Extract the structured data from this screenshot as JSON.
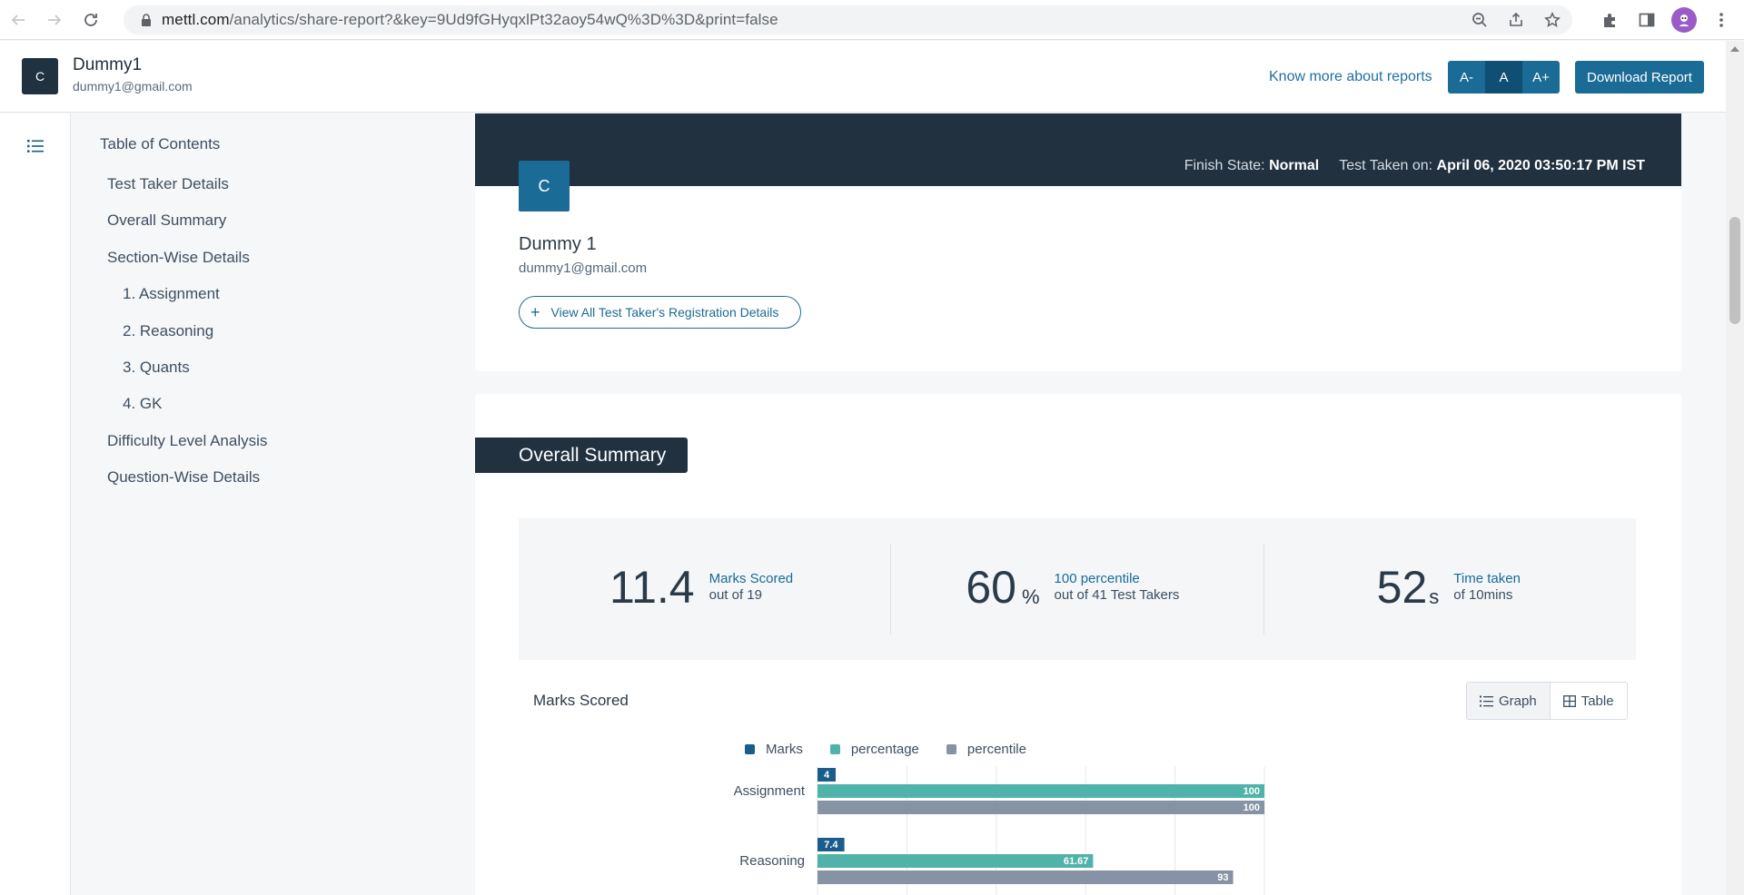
{
  "browser": {
    "url_host": "mettl.com",
    "url_rest": "/analytics/share-report?&key=9Ud9fGHyqxlPt32aoy54wQ%3D%3D&print=false"
  },
  "header": {
    "avatar_letter": "C",
    "user_name": "Dummy1",
    "user_email": "dummy1@gmail.com",
    "know_more": "Know more about reports",
    "font_decrease": "A-",
    "font_normal": "A",
    "font_increase": "A+",
    "download": "Download Report"
  },
  "toc": {
    "title": "Table of Contents",
    "items": [
      "Test Taker Details",
      "Overall Summary",
      "Section-Wise Details",
      "1. Assignment",
      "2. Reasoning",
      "3. Quants",
      "4. GK",
      "Difficulty Level Analysis",
      "Question-Wise Details"
    ]
  },
  "profile": {
    "finish_state_label": "Finish State:",
    "finish_state_value": "Normal",
    "taken_on_label": "Test Taken on:",
    "taken_on_value": "April 06, 2020 03:50:17 PM IST",
    "avatar_letter": "C",
    "name": "Dummy 1",
    "email": "dummy1@gmail.com",
    "registration_button": "View All Test Taker's Registration Details"
  },
  "summary": {
    "section_title": "Overall Summary",
    "stats": [
      {
        "value": "11.4",
        "unit": "",
        "label": "Marks Scored",
        "sub": "out of 19"
      },
      {
        "value": "60",
        "unit": "%",
        "label": "100 percentile",
        "sub": "out of 41 Test Takers"
      },
      {
        "value": "52",
        "unit": "s",
        "label": "Time taken",
        "sub": "of 10mins"
      }
    ],
    "chart_title": "Marks Scored",
    "view_graph": "Graph",
    "view_table": "Table"
  },
  "chart_data": {
    "type": "bar",
    "orientation": "horizontal",
    "categories": [
      "Assignment",
      "Reasoning"
    ],
    "series": [
      {
        "name": "Marks",
        "values": [
          4,
          7.4
        ],
        "color": "#1a5d8c"
      },
      {
        "name": "percentage",
        "values": [
          100,
          61.67
        ],
        "color": "#4fb3a9"
      },
      {
        "name": "percentile",
        "values": [
          100,
          93
        ],
        "color": "#8593a4"
      }
    ],
    "xlim": [
      0,
      100
    ],
    "grid": true,
    "legend": "top"
  }
}
